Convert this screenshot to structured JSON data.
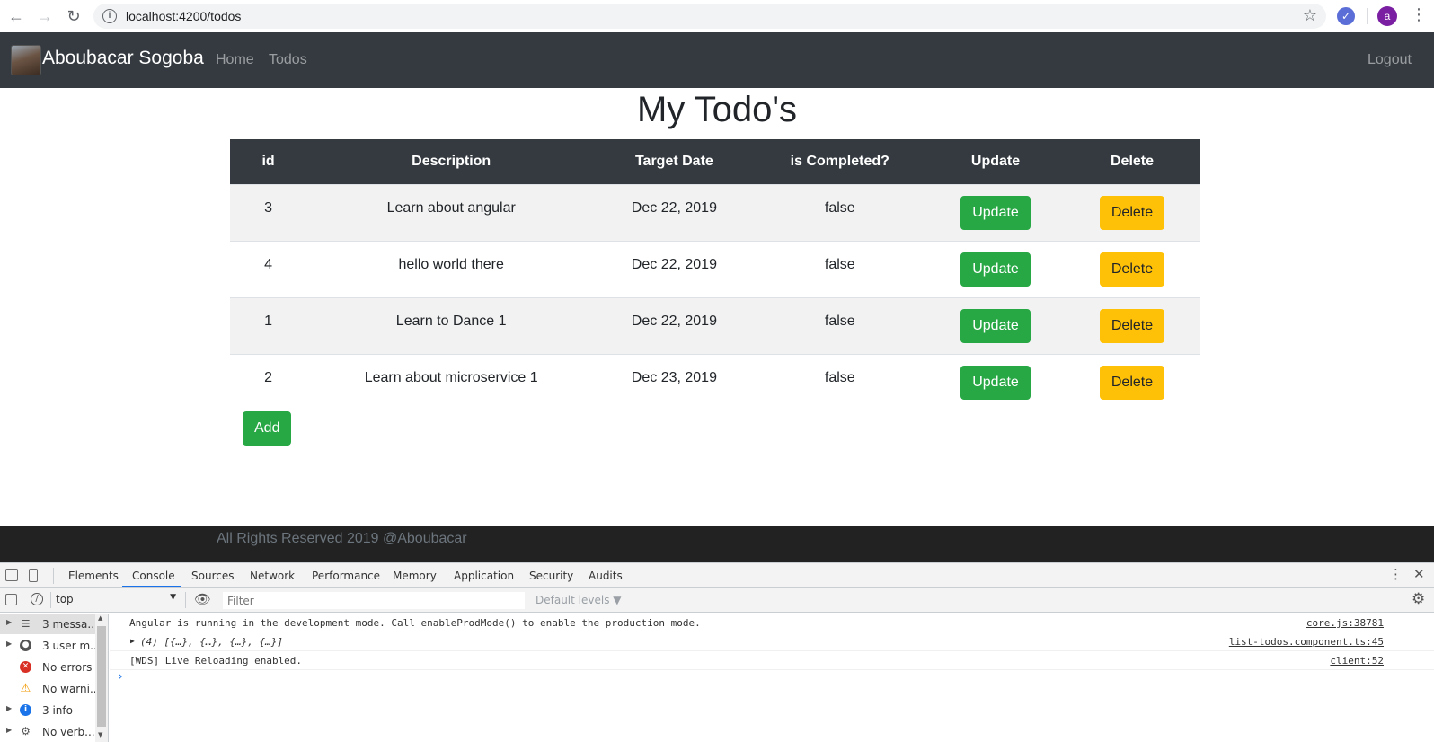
{
  "browser": {
    "url": "localhost:4200/todos",
    "profile_initial": "a"
  },
  "navbar": {
    "brand": "Aboubacar Sogoba",
    "links": [
      "Home",
      "Todos"
    ],
    "logout": "Logout"
  },
  "page": {
    "title": "My Todo's"
  },
  "table": {
    "headers": [
      "id",
      "Description",
      "Target Date",
      "is Completed?",
      "Update",
      "Delete"
    ],
    "rows": [
      {
        "id": "3",
        "description": "Learn about angular",
        "target_date": "Dec 22, 2019",
        "completed": "false",
        "update": "Update",
        "delete": "Delete"
      },
      {
        "id": "4",
        "description": "hello world there",
        "target_date": "Dec 22, 2019",
        "completed": "false",
        "update": "Update",
        "delete": "Delete"
      },
      {
        "id": "1",
        "description": "Learn to Dance 1",
        "target_date": "Dec 22, 2019",
        "completed": "false",
        "update": "Update",
        "delete": "Delete"
      },
      {
        "id": "2",
        "description": "Learn about microservice 1",
        "target_date": "Dec 23, 2019",
        "completed": "false",
        "update": "Update",
        "delete": "Delete"
      }
    ]
  },
  "add_button": "Add",
  "footer": {
    "text": "All Rights Reserved 2019 @Aboubacar"
  },
  "devtools": {
    "tabs": [
      "Elements",
      "Console",
      "Sources",
      "Network",
      "Performance",
      "Memory",
      "Application",
      "Security",
      "Audits"
    ],
    "active_tab": "Console",
    "context": "top",
    "filter_placeholder": "Filter",
    "levels": "Default levels ▼",
    "sidebar": [
      {
        "label": "3 messa...",
        "icon": "list-icon"
      },
      {
        "label": "3 user m...",
        "icon": "user-icon"
      },
      {
        "label": "No errors",
        "icon": "error-icon"
      },
      {
        "label": "No warni...",
        "icon": "warning-icon"
      },
      {
        "label": "3 info",
        "icon": "info-icon"
      },
      {
        "label": "No verb...",
        "icon": "verbose-icon"
      }
    ],
    "messages": [
      {
        "text": "Angular is running in the development mode. Call enableProdMode() to enable the production mode.",
        "source": "core.js:38781"
      },
      {
        "text": "(4) [{…}, {…}, {…}, {…}]",
        "source": "list-todos.component.ts:45"
      },
      {
        "text": "[WDS] Live Reloading enabled.",
        "source": "client:52"
      }
    ]
  },
  "colors": {
    "navbar": "#343a40",
    "success": "#28a745",
    "warning": "#ffc107",
    "footer": "#222222"
  }
}
